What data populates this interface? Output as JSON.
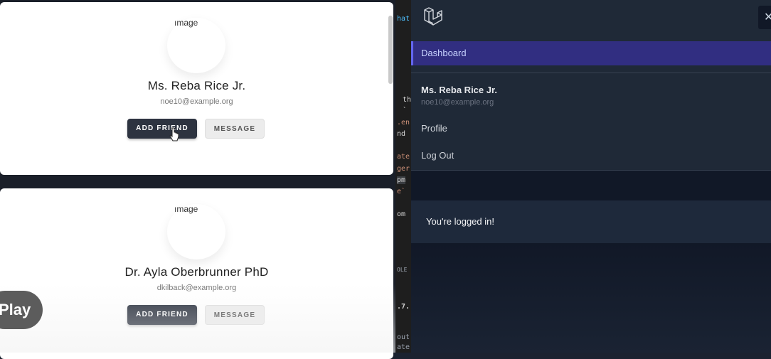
{
  "cards": [
    {
      "avatar_alt": "ımage",
      "name": "Ms. Reba Rice Jr.",
      "email": "noe10@example.org",
      "add_friend_label": "ADD FRIEND",
      "message_label": "MESSAGE"
    },
    {
      "avatar_alt": "ımage",
      "name": "Dr. Ayla Oberbrunner PhD",
      "email": "dkilback@example.org",
      "add_friend_label": "ADD FRIEND",
      "message_label": "MESSAGE"
    }
  ],
  "video": {
    "play_label": "Play"
  },
  "code_fragments": [
    {
      "text": "hat",
      "color": "#4fc1ff"
    },
    {
      "text": "th",
      "color": "#d4d4d4"
    },
    {
      "text": "`",
      "color": "#d4d4d4"
    },
    {
      "text": ".en",
      "color": "#ce9178"
    },
    {
      "text": "nd",
      "color": "#d4d4d4"
    },
    {
      "text": "ate",
      "color": "#ce9178"
    },
    {
      "text": "ger",
      "color": "#ce9178"
    },
    {
      "text": "pm",
      "color": "#d4d4d4"
    },
    {
      "text": "e`",
      "color": "#ce9178"
    },
    {
      "text": "om",
      "color": "#d4d4d4"
    },
    {
      "text": "OLE",
      "color": "#9ca3af"
    },
    {
      "text": ".7.",
      "color": "#d4d4d4"
    },
    {
      "text": "out",
      "color": "#9ca3af"
    },
    {
      "text": "ate",
      "color": "#9ca3af"
    }
  ],
  "sidebar": {
    "close_glyph": "✕",
    "nav_active": "Dashboard",
    "user": {
      "name": "Ms. Reba Rice Jr.",
      "email": "noe10@example.org"
    },
    "links": [
      "Profile",
      "Log Out"
    ]
  },
  "main": {
    "status_message": "You're logged in!"
  },
  "colors": {
    "accent": "#6366f1",
    "panel_bg": "#1f2937",
    "button_dark": "#2d3340"
  }
}
